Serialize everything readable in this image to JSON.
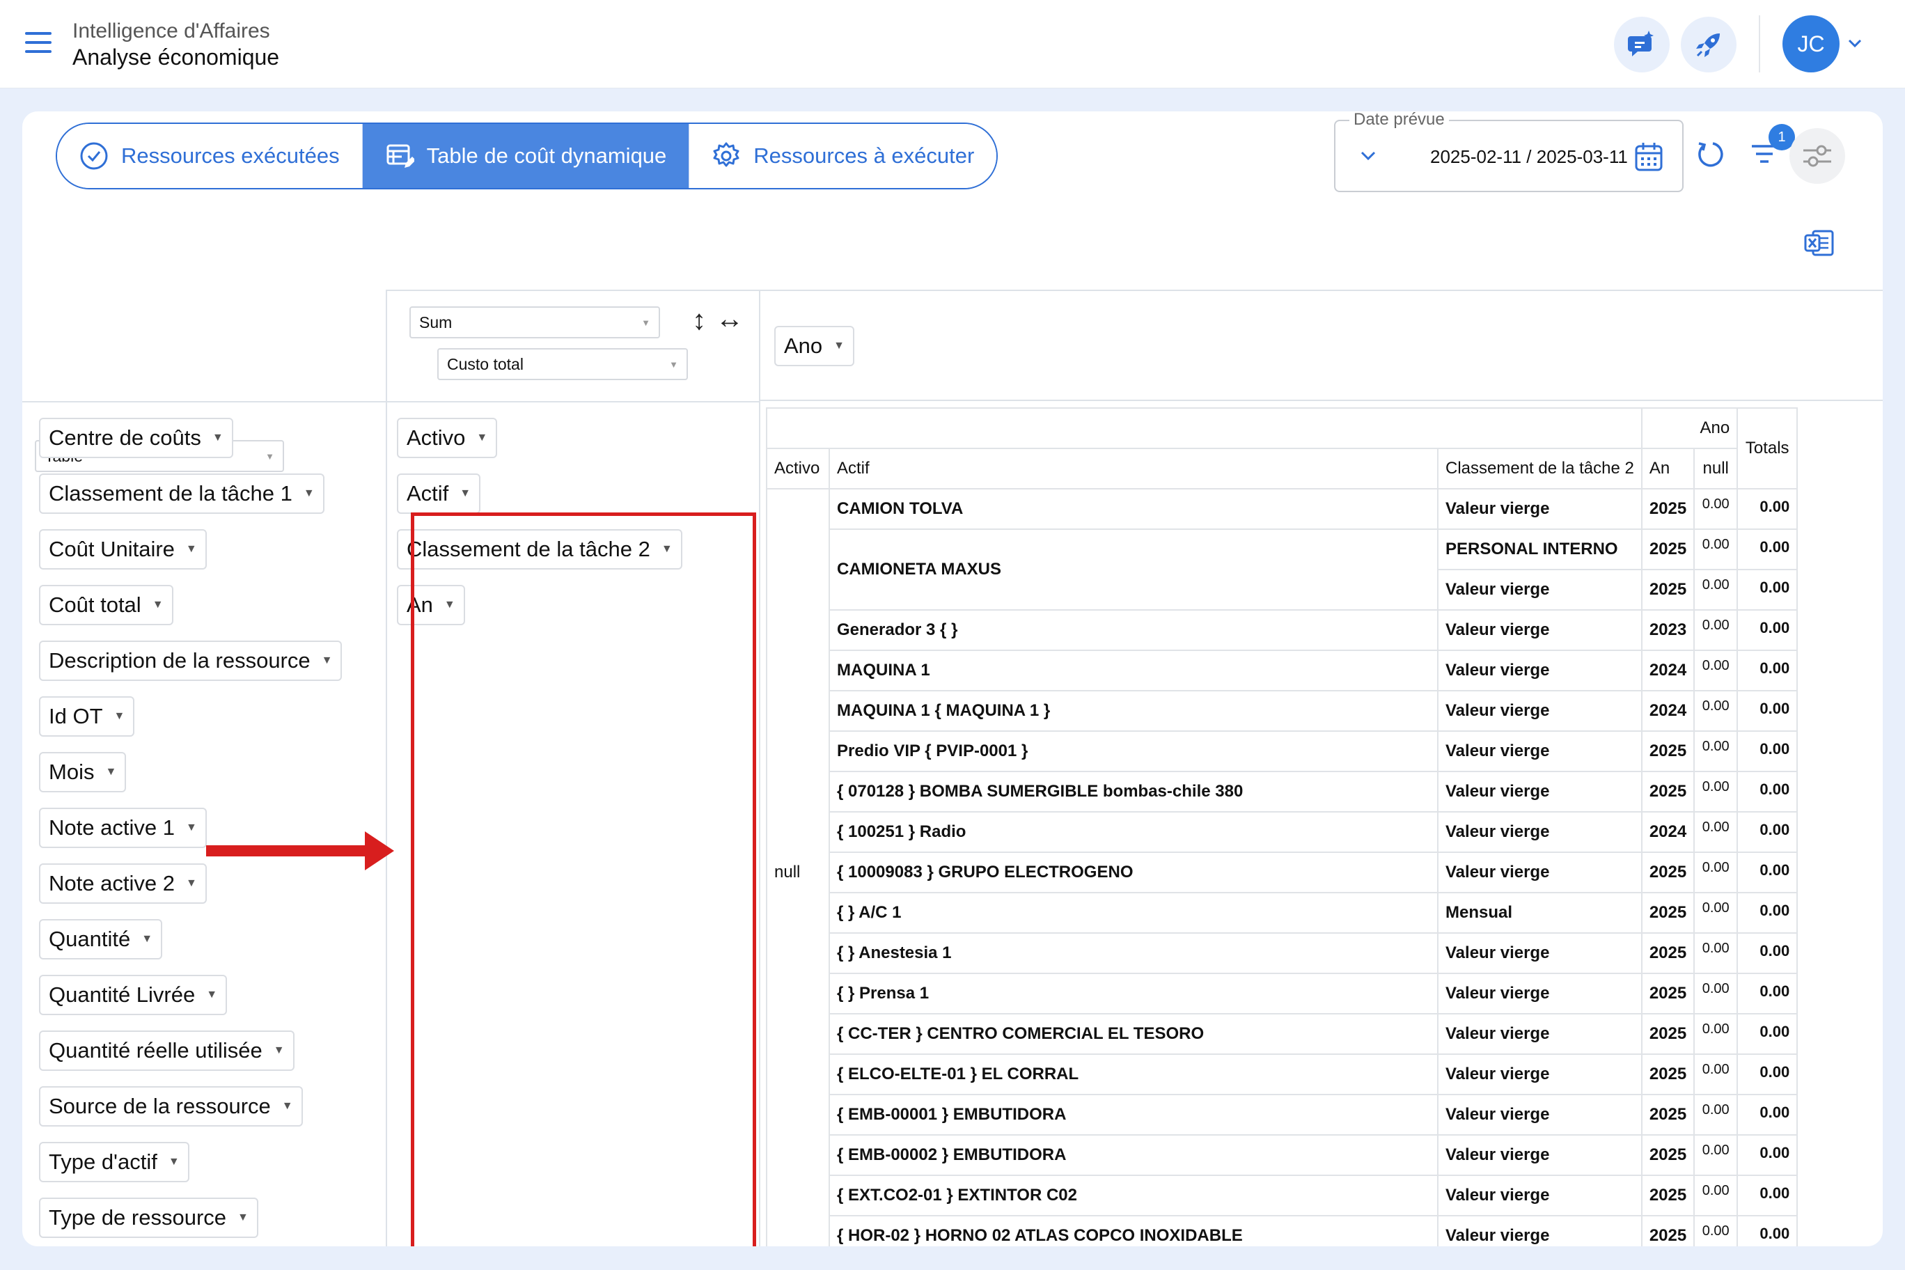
{
  "header": {
    "subtitle": "Intelligence d'Affaires",
    "title": "Analyse économique",
    "avatar_initials": "JC"
  },
  "tabs": [
    {
      "label": "Ressources exécutées",
      "icon": "check-circle-icon",
      "active": false
    },
    {
      "label": "Table de coût dynamique",
      "icon": "table-edit-icon",
      "active": true
    },
    {
      "label": "Ressources à exécuter",
      "icon": "gear-icon",
      "active": false
    }
  ],
  "date_filter": {
    "legend": "Date prévue",
    "value": "2025-02-11 / 2025-03-11"
  },
  "filter_badge_count": "1",
  "colors": {
    "accent": "#2f6fd6",
    "tab_active": "#4a86e0",
    "highlight_box": "#d81e1e"
  },
  "pivot": {
    "renderer": "Table",
    "aggregator": "Sum",
    "value_field": "Custo total",
    "column_field": "Ano",
    "unused_fields": [
      "Centre de coûts",
      "Classement de la tâche 1",
      "Coût Unitaire",
      "Coût total",
      "Description de la ressource",
      "Id OT",
      "Mois",
      "Note active 1",
      "Note active 2",
      "Quantité",
      "Quantité Livrée",
      "Quantité réelle utilisée",
      "Source de la ressource",
      "Type d'actif",
      "Type de ressource"
    ],
    "row_fields": [
      "Activo",
      "Actif",
      "Classement de la tâche 2",
      "An"
    ],
    "table": {
      "col_header_label": "Ano",
      "null_header": "null",
      "totals_header": "Totals",
      "row_headers": [
        "Activo",
        "Actif",
        "Classement de la tâche 2",
        "An"
      ],
      "activo_value": "null",
      "rows": [
        {
          "actif": "CAMION TOLVA",
          "cls": "Valeur vierge",
          "an": "2025",
          "null": "0.00",
          "total": "0.00"
        },
        {
          "actif": "CAMIONETA MAXUS",
          "cls": "PERSONAL INTERNO",
          "an": "2025",
          "null": "0.00",
          "total": "0.00"
        },
        {
          "actif": "",
          "cls": "Valeur vierge",
          "an": "2025",
          "null": "0.00",
          "total": "0.00"
        },
        {
          "actif": "Generador 3 { }",
          "cls": "Valeur vierge",
          "an": "2023",
          "null": "0.00",
          "total": "0.00"
        },
        {
          "actif": "MAQUINA 1",
          "cls": "Valeur vierge",
          "an": "2024",
          "null": "0.00",
          "total": "0.00"
        },
        {
          "actif": "MAQUINA 1 { MAQUINA 1 }",
          "cls": "Valeur vierge",
          "an": "2024",
          "null": "0.00",
          "total": "0.00"
        },
        {
          "actif": "Predio VIP { PVIP-0001 }",
          "cls": "Valeur vierge",
          "an": "2025",
          "null": "0.00",
          "total": "0.00"
        },
        {
          "actif": "{ 070128 } BOMBA SUMERGIBLE bombas-chile 380",
          "cls": "Valeur vierge",
          "an": "2025",
          "null": "0.00",
          "total": "0.00"
        },
        {
          "actif": "{ 100251 } Radio",
          "cls": "Valeur vierge",
          "an": "2024",
          "null": "0.00",
          "total": "0.00"
        },
        {
          "actif": "{ 10009083 } GRUPO ELECTROGENO",
          "cls": "Valeur vierge",
          "an": "2025",
          "null": "0.00",
          "total": "0.00"
        },
        {
          "actif": "{ } A/C 1",
          "cls": "Mensual",
          "an": "2025",
          "null": "0.00",
          "total": "0.00"
        },
        {
          "actif": "{ } Anestesia 1",
          "cls": "Valeur vierge",
          "an": "2025",
          "null": "0.00",
          "total": "0.00"
        },
        {
          "actif": "{ } Prensa 1",
          "cls": "Valeur vierge",
          "an": "2025",
          "null": "0.00",
          "total": "0.00"
        },
        {
          "actif": "{ CC-TER } CENTRO COMERCIAL EL TESORO",
          "cls": "Valeur vierge",
          "an": "2025",
          "null": "0.00",
          "total": "0.00"
        },
        {
          "actif": "{ ELCO-ELTE-01 } EL CORRAL",
          "cls": "Valeur vierge",
          "an": "2025",
          "null": "0.00",
          "total": "0.00"
        },
        {
          "actif": "{ EMB-00001 } EMBUTIDORA",
          "cls": "Valeur vierge",
          "an": "2025",
          "null": "0.00",
          "total": "0.00"
        },
        {
          "actif": "{ EMB-00002 } EMBUTIDORA",
          "cls": "Valeur vierge",
          "an": "2025",
          "null": "0.00",
          "total": "0.00"
        },
        {
          "actif": "{ EXT.CO2-01 } EXTINTOR C02",
          "cls": "Valeur vierge",
          "an": "2025",
          "null": "0.00",
          "total": "0.00"
        },
        {
          "actif": "{ HOR-02 } HORNO 02 ATLAS COPCO INOXIDABLE",
          "cls": "Valeur vierge",
          "an": "2025",
          "null": "0.00",
          "total": "0.00"
        }
      ]
    }
  }
}
